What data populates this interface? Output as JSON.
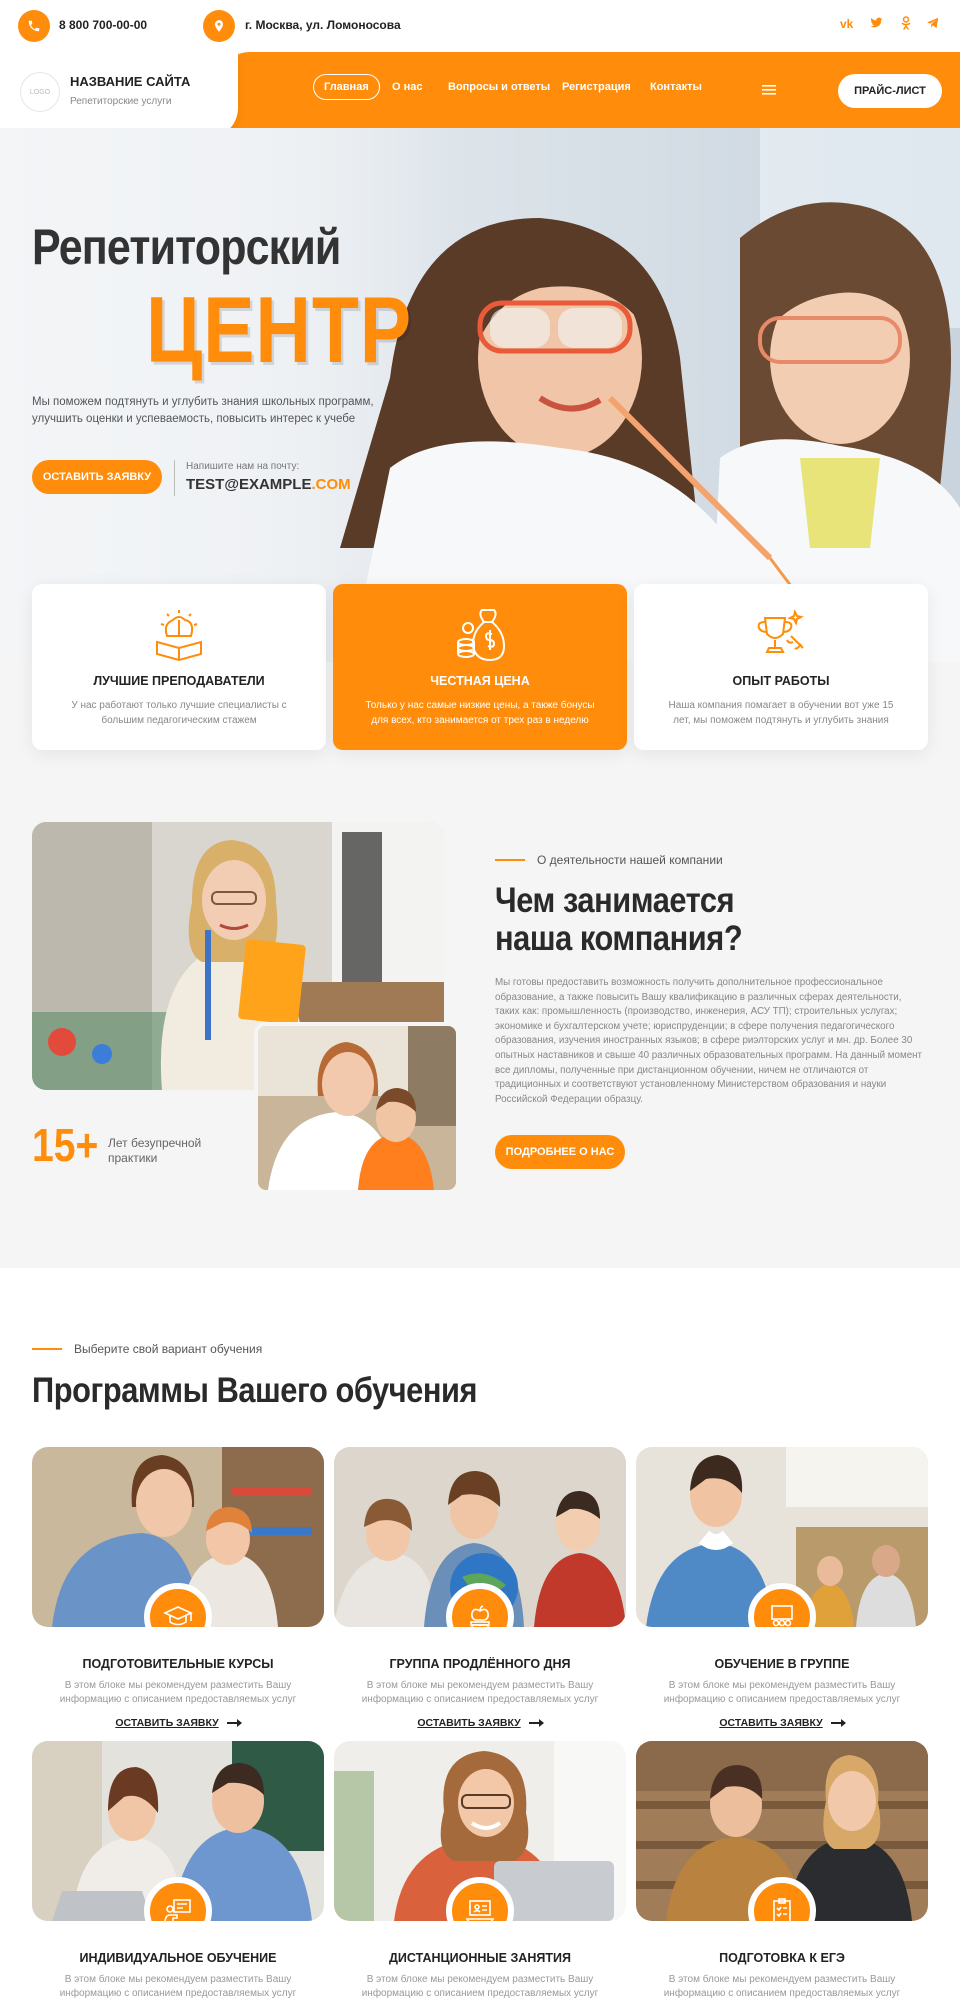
{
  "colors": {
    "accent": "#ff8c0a",
    "dark": "#2b2b2b",
    "muted": "#888888"
  },
  "topbar": {
    "phone": "8 800 700-00-00",
    "address": "г. Москва, ул. Ломоносова",
    "socials": [
      "vk-icon",
      "twitter-icon",
      "odnoklassniki-icon",
      "telegram-icon"
    ]
  },
  "brand": {
    "logo_text": "LOGO",
    "site_name": "НАЗВАНИЕ САЙТА",
    "tagline": "Репетиторские услуги"
  },
  "nav": {
    "items": [
      "Главная",
      "О нас",
      "Вопросы и ответы",
      "Регистрация",
      "Контакты"
    ],
    "active_index": 0,
    "price_button": "ПРАЙС-ЛИСТ"
  },
  "hero": {
    "title_line1": "Репетиторский",
    "title_line2": "ЦЕНТР",
    "subtitle": "Мы поможем подтянуть и углубить знания школьных программ, улучшить оценки и успеваемость, повысить интерес к учебе",
    "cta": "ОСТАВИТЬ ЗАЯВКУ",
    "mail_hint": "Напишите нам на почту:",
    "mail_main": "TEST@EXAMPLE",
    "mail_suffix": ".COM"
  },
  "features": [
    {
      "title": "ЛУЧШИЕ ПРЕПОДАВАТЕЛИ",
      "desc": "У нас работают только лучшие специалисты с большим педагогическим стажем",
      "icon": "brain-book-icon",
      "active": false
    },
    {
      "title": "ЧЕСТНАЯ ЦЕНА",
      "desc": "Только у нас самые низкие цены, а также бонусы для всех, кто занимается от трех раз в неделю",
      "icon": "money-bag-icon",
      "active": true
    },
    {
      "title": "ОПЫТ РАБОТЫ",
      "desc": "Наша компания помагает в обучении вот уже 15 лет, мы поможем подтянуть и углубить знания",
      "icon": "trophy-icon",
      "active": false
    }
  ],
  "about": {
    "kicker": "О деятельности нашей компании",
    "title": "Чем занимается наша компания?",
    "text": "Мы готовы предоставить возможность получить дополнительное профессиональное образование, а также повысить Вашу квалификацию в различных сферах деятельности, таких как: промышленность (производство, инженерия, АСУ ТП); строительных услугах; экономике и бухгалтерском учете; юриспруденции; в сфере получения педагогического образования, изучения иностранных языков; в сфере риэлторских услуг и мн. др. Более 30 опытных наставников и свыше 40 различных образовательных программ. На данный момент все дипломы, полученные при дистанционном обучении, ничем не отличаются от традиционных и соответствуют установленному Министерством образования и науки Российской Федерации образцу.",
    "button": "ПОДРОБНЕЕ О НАС",
    "years": "15+",
    "years_label": "Лет безупречной практики"
  },
  "programs": {
    "kicker": "Выберите свой вариант обучения",
    "title": "Программы Вашего обучения",
    "link_label": "ОСТАВИТЬ ЗАЯВКУ",
    "items": [
      {
        "title": "ПОДГОТОВИТЕЛЬНЫЕ КУРСЫ",
        "desc": "В этом блоке мы рекомендуем разместить Вашу информацию с описанием предоставляемых услуг",
        "icon": "graduation-cap-icon"
      },
      {
        "title": "ГРУППА ПРОДЛЁННОГО ДНЯ",
        "desc": "В этом блоке мы рекомендуем разместить Вашу информацию с описанием предоставляемых услуг",
        "icon": "apple-books-icon"
      },
      {
        "title": "ОБУЧЕНИЕ В ГРУППЕ",
        "desc": "В этом блоке мы рекомендуем разместить Вашу информацию с описанием предоставляемых услуг",
        "icon": "group-board-icon"
      },
      {
        "title": "ИНДИВИДУАЛЬНОЕ ОБУЧЕНИЕ",
        "desc": "В этом блоке мы рекомендуем разместить Вашу информацию с описанием предоставляемых услуг",
        "icon": "tutor-board-icon"
      },
      {
        "title": "ДИСТАНЦИОННЫЕ ЗАНЯТИЯ",
        "desc": "В этом блоке мы рекомендуем разместить Вашу информацию с описанием предоставляемых услуг",
        "icon": "laptop-lesson-icon"
      },
      {
        "title": "ПОДГОТОВКА К ЕГЭ",
        "desc": "В этом блоке мы рекомендуем разместить Вашу информацию с описанием предоставляемых услуг",
        "icon": "checklist-icon"
      }
    ]
  }
}
